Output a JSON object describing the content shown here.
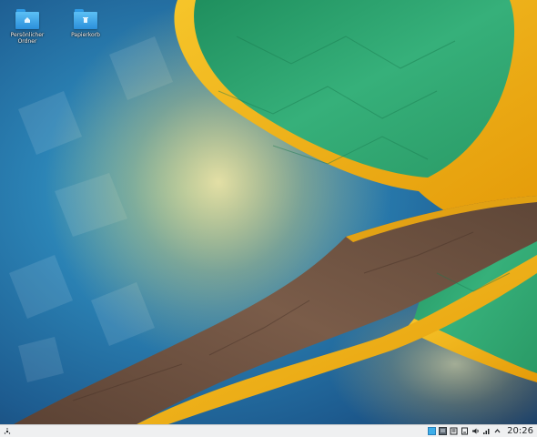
{
  "desktop": {
    "icons": [
      {
        "label": "Persönlicher\nOrdner",
        "icon": "home-folder-icon"
      },
      {
        "label": "Papierkorb",
        "icon": "trash-folder-icon"
      }
    ]
  },
  "colors": {
    "ring_gold": "#f2b30e",
    "green_field": "#2fa76b",
    "brown_band": "#6e5544",
    "sky_blue": "#2a7cb0",
    "taskbar_bg": "#eff0f1"
  },
  "taskbar": {
    "launcher_icon": "kde-menu-icon",
    "tray": [
      "pager-desktop-1-icon",
      "pager-desktop-2-icon",
      "notifications-icon",
      "device-notifier-icon",
      "volume-icon",
      "network-icon",
      "expand-tray-icon"
    ],
    "clock": "20:26"
  }
}
